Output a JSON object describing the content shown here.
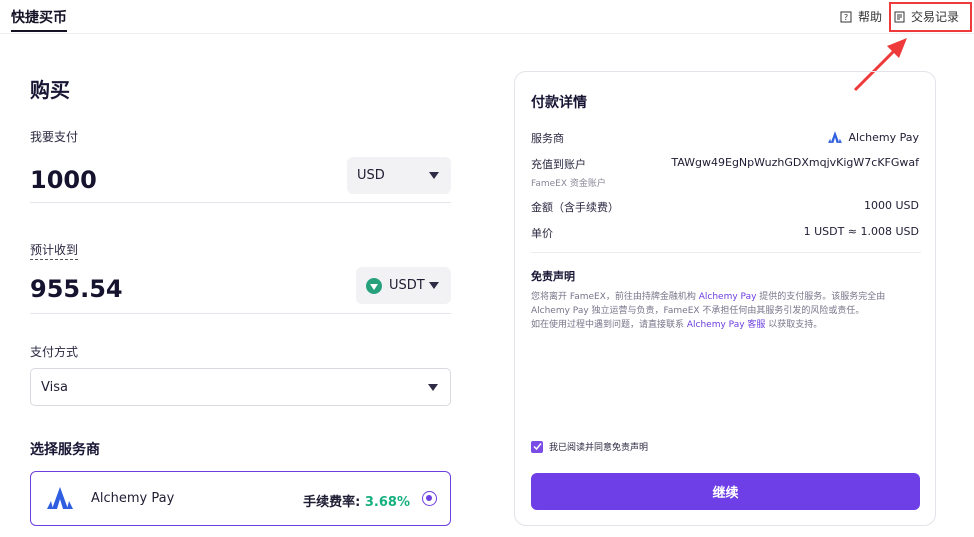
{
  "header": {
    "tab_label": "快捷买币",
    "help_label": "帮助",
    "records_label": "交易记录"
  },
  "buy": {
    "title": "购买",
    "pay_label": "我要支付",
    "pay_amount": "1000",
    "pay_currency": "USD",
    "receive_label": "预计收到",
    "receive_amount": "955.54",
    "receive_currency": "USDT",
    "method_label": "支付方式",
    "method_value": "Visa",
    "provider_section": "选择服务商",
    "provider_name": "Alchemy Pay",
    "fee_label": "手续费率:",
    "fee_value": "3.68%"
  },
  "details": {
    "title": "付款详情",
    "provider_label": "服务商",
    "provider_value": "Alchemy Pay",
    "account_label": "充值到账户",
    "account_value": "TAWgw49EgNpWuzhGDXmqjvKigW7cKFGwaf",
    "account_sub": "FameEX 资金账户",
    "total_label": "金额（含手续费）",
    "total_value": "1000 USD",
    "price_label": "单价",
    "price_value": "1 USDT ≈ 1.008 USD",
    "disclaimer_title": "免责声明",
    "disclaimer_p1": "您将离开 FameEX，前往由持牌金融机构 ",
    "disclaimer_hl1": "Alchemy Pay",
    "disclaimer_p2": " 提供的支付服务。该服务完全由 Alchemy Pay 独立运营与负责，FameEX 不承担任何由其服务引发的风险或责任。",
    "disclaimer_p3": "如在使用过程中遇到问题，请直接联系 ",
    "disclaimer_hl2": "Alchemy Pay 客服",
    "disclaimer_p4": " 以获取支持。",
    "agree_label": "我已阅读并同意免责声明",
    "continue_label": "继续"
  },
  "colors": {
    "accent": "#6e3fe6",
    "fee_green": "#17b07f",
    "highlight_red": "#ee3a3a"
  }
}
